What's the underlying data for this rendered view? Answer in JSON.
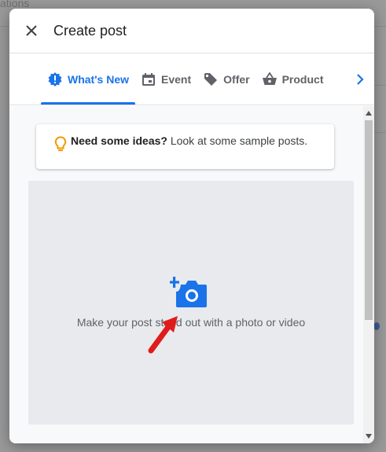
{
  "background": {
    "partial_tab_text": "ations"
  },
  "dialog": {
    "title": "Create post",
    "close_icon": "close-icon"
  },
  "tabs": [
    {
      "label": "What's New",
      "icon": "alert-badge-icon",
      "active": true
    },
    {
      "label": "Event",
      "icon": "calendar-icon",
      "active": false
    },
    {
      "label": "Offer",
      "icon": "tag-icon",
      "active": false
    },
    {
      "label": "Product",
      "icon": "shopping-basket-icon",
      "active": false
    }
  ],
  "ideas_card": {
    "bold": "Need some ideas?",
    "text": " Look at some sample posts."
  },
  "upload": {
    "text": "Make your post stand out with a photo or video",
    "icon": "add-photo-camera-icon"
  },
  "colors": {
    "accent": "#1a73e8",
    "bulb": "#f29900",
    "pointer": "#e01b1b"
  }
}
